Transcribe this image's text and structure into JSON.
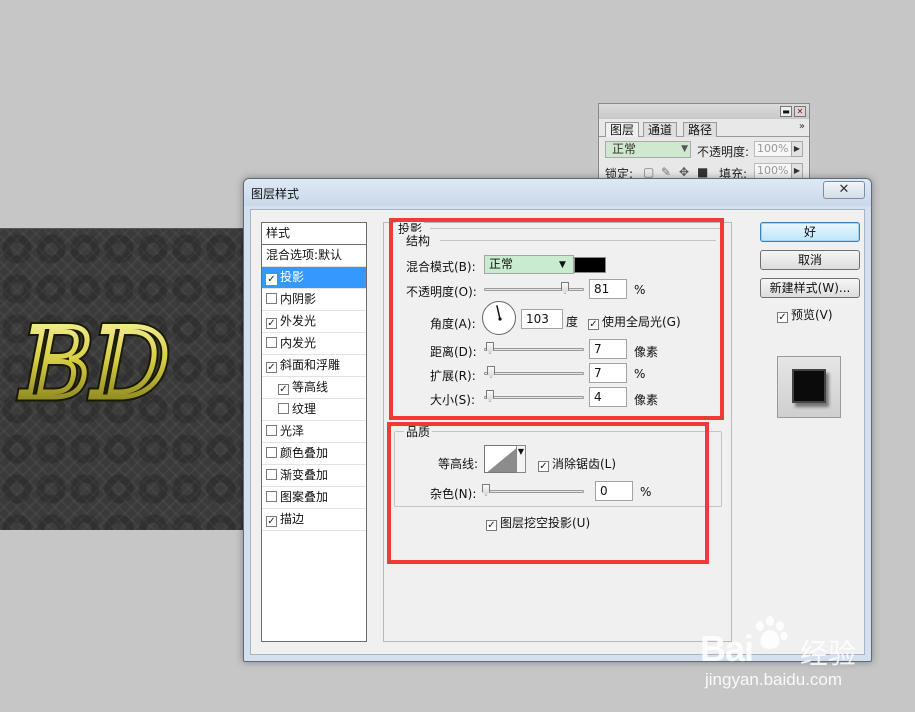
{
  "layers_panel": {
    "tabs": [
      "图层",
      "通道",
      "路径"
    ],
    "blend_mode": "正常",
    "opacity_label": "不透明度:",
    "opacity_value": "100%",
    "lock_label": "锁定:",
    "fill_label": "填充:",
    "fill_value": "100%"
  },
  "dialog": {
    "title": "图层样式",
    "close_glyph": "✕",
    "styles_list": {
      "header": "样式",
      "items": [
        {
          "label": "混合选项:默认",
          "has_checkbox": false,
          "checked": false,
          "selected": false,
          "indent": false
        },
        {
          "label": "投影",
          "has_checkbox": true,
          "checked": true,
          "selected": true,
          "indent": false
        },
        {
          "label": "内阴影",
          "has_checkbox": true,
          "checked": false,
          "selected": false,
          "indent": false
        },
        {
          "label": "外发光",
          "has_checkbox": true,
          "checked": true,
          "selected": false,
          "indent": false
        },
        {
          "label": "内发光",
          "has_checkbox": true,
          "checked": false,
          "selected": false,
          "indent": false
        },
        {
          "label": "斜面和浮雕",
          "has_checkbox": true,
          "checked": true,
          "selected": false,
          "indent": false
        },
        {
          "label": "等高线",
          "has_checkbox": true,
          "checked": true,
          "selected": false,
          "indent": true
        },
        {
          "label": "纹理",
          "has_checkbox": true,
          "checked": false,
          "selected": false,
          "indent": true
        },
        {
          "label": "光泽",
          "has_checkbox": true,
          "checked": false,
          "selected": false,
          "indent": false
        },
        {
          "label": "颜色叠加",
          "has_checkbox": true,
          "checked": false,
          "selected": false,
          "indent": false
        },
        {
          "label": "渐变叠加",
          "has_checkbox": true,
          "checked": false,
          "selected": false,
          "indent": false
        },
        {
          "label": "图案叠加",
          "has_checkbox": true,
          "checked": false,
          "selected": false,
          "indent": false
        },
        {
          "label": "描边",
          "has_checkbox": true,
          "checked": true,
          "selected": false,
          "indent": false
        }
      ]
    },
    "drop_shadow": {
      "section_title": "投影",
      "structure": {
        "title": "结构",
        "blend_mode_label": "混合模式(B):",
        "blend_mode_value": "正常",
        "shadow_color": "#000000",
        "opacity_label": "不透明度(O):",
        "opacity_value": "81",
        "opacity_unit": "%",
        "opacity_fraction": 0.81,
        "angle_label": "角度(A):",
        "angle_value": "103",
        "angle_unit": "度",
        "global_light_label": "使用全局光(G)",
        "global_light_checked": true,
        "distance_label": "距离(D):",
        "distance_value": "7",
        "distance_unit": "像素",
        "spread_label": "扩展(R):",
        "spread_value": "7",
        "spread_unit": "%",
        "size_label": "大小(S):",
        "size_value": "4",
        "size_unit": "像素"
      },
      "quality": {
        "title": "品质",
        "contour_label": "等高线:",
        "anti_alias_label": "消除锯齿(L)",
        "anti_alias_checked": true,
        "noise_label": "杂色(N):",
        "noise_value": "0",
        "noise_unit": "%"
      },
      "knockout_label": "图层挖空投影(U)",
      "knockout_checked": true
    },
    "buttons": {
      "ok": "好",
      "cancel": "取消",
      "new_style": "新建样式(W)..."
    },
    "preview_label": "预览(V)",
    "preview_checked": true
  },
  "canvas_text": "BD",
  "watermark": {
    "brand": "Bai",
    "brand_cn": "经验",
    "url": "jingyan.baidu.com"
  },
  "colors": {
    "selection": "#3399ff",
    "annotation_red": "#ee3a3a",
    "blend_field": "#c9ebcf"
  }
}
